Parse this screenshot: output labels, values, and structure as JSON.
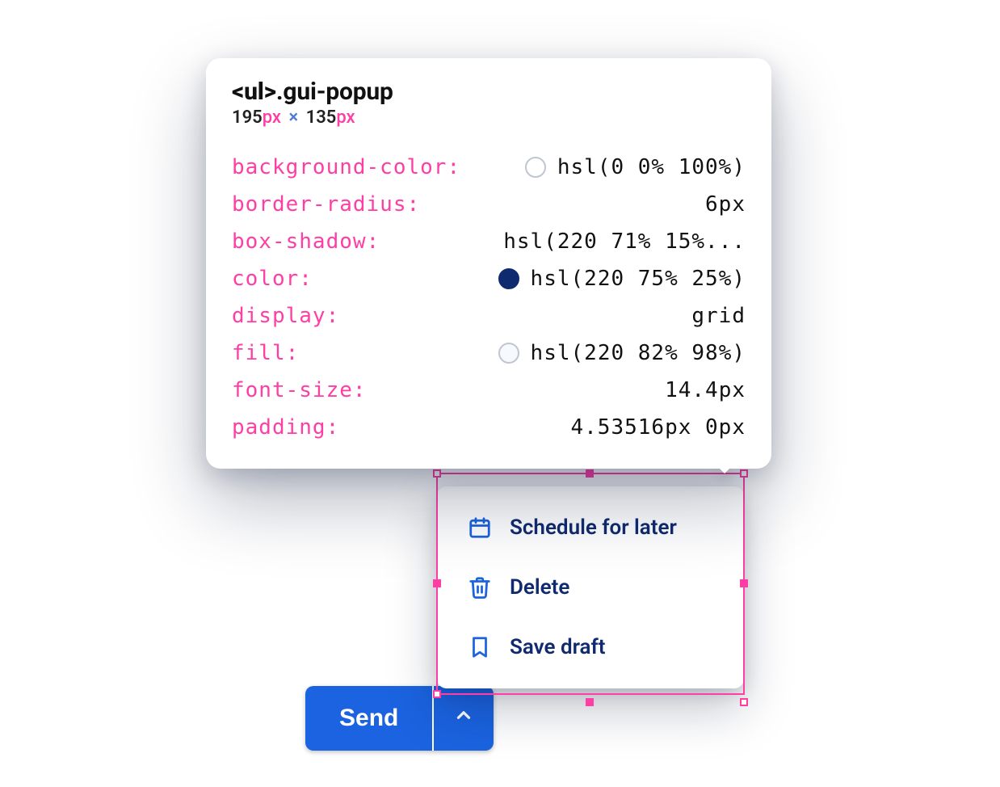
{
  "send": {
    "label": "Send"
  },
  "popup": {
    "items": [
      {
        "icon": "calendar-icon",
        "label": "Schedule for later"
      },
      {
        "icon": "trash-icon",
        "label": "Delete"
      },
      {
        "icon": "bookmark-icon",
        "label": "Save draft"
      }
    ]
  },
  "tooltip": {
    "selector_tag": "<ul>",
    "selector_class": ".gui-popup",
    "size": {
      "w": "195",
      "h": "135",
      "unit": "px"
    },
    "props": [
      {
        "key": "background-color",
        "value": "hsl(0 0% 100%)",
        "swatch": "#ffffff"
      },
      {
        "key": "border-radius",
        "value": "6px"
      },
      {
        "key": "box-shadow",
        "value": "hsl(220 71% 15%..."
      },
      {
        "key": "color",
        "value": "hsl(220 75% 25%)",
        "swatch": "#102a6f"
      },
      {
        "key": "display",
        "value": "grid"
      },
      {
        "key": "fill",
        "value": "hsl(220 82% 98%)",
        "swatch": "#f6f9fe"
      },
      {
        "key": "font-size",
        "value": "14.4px"
      },
      {
        "key": "padding",
        "value": "4.53516px 0px"
      }
    ]
  }
}
